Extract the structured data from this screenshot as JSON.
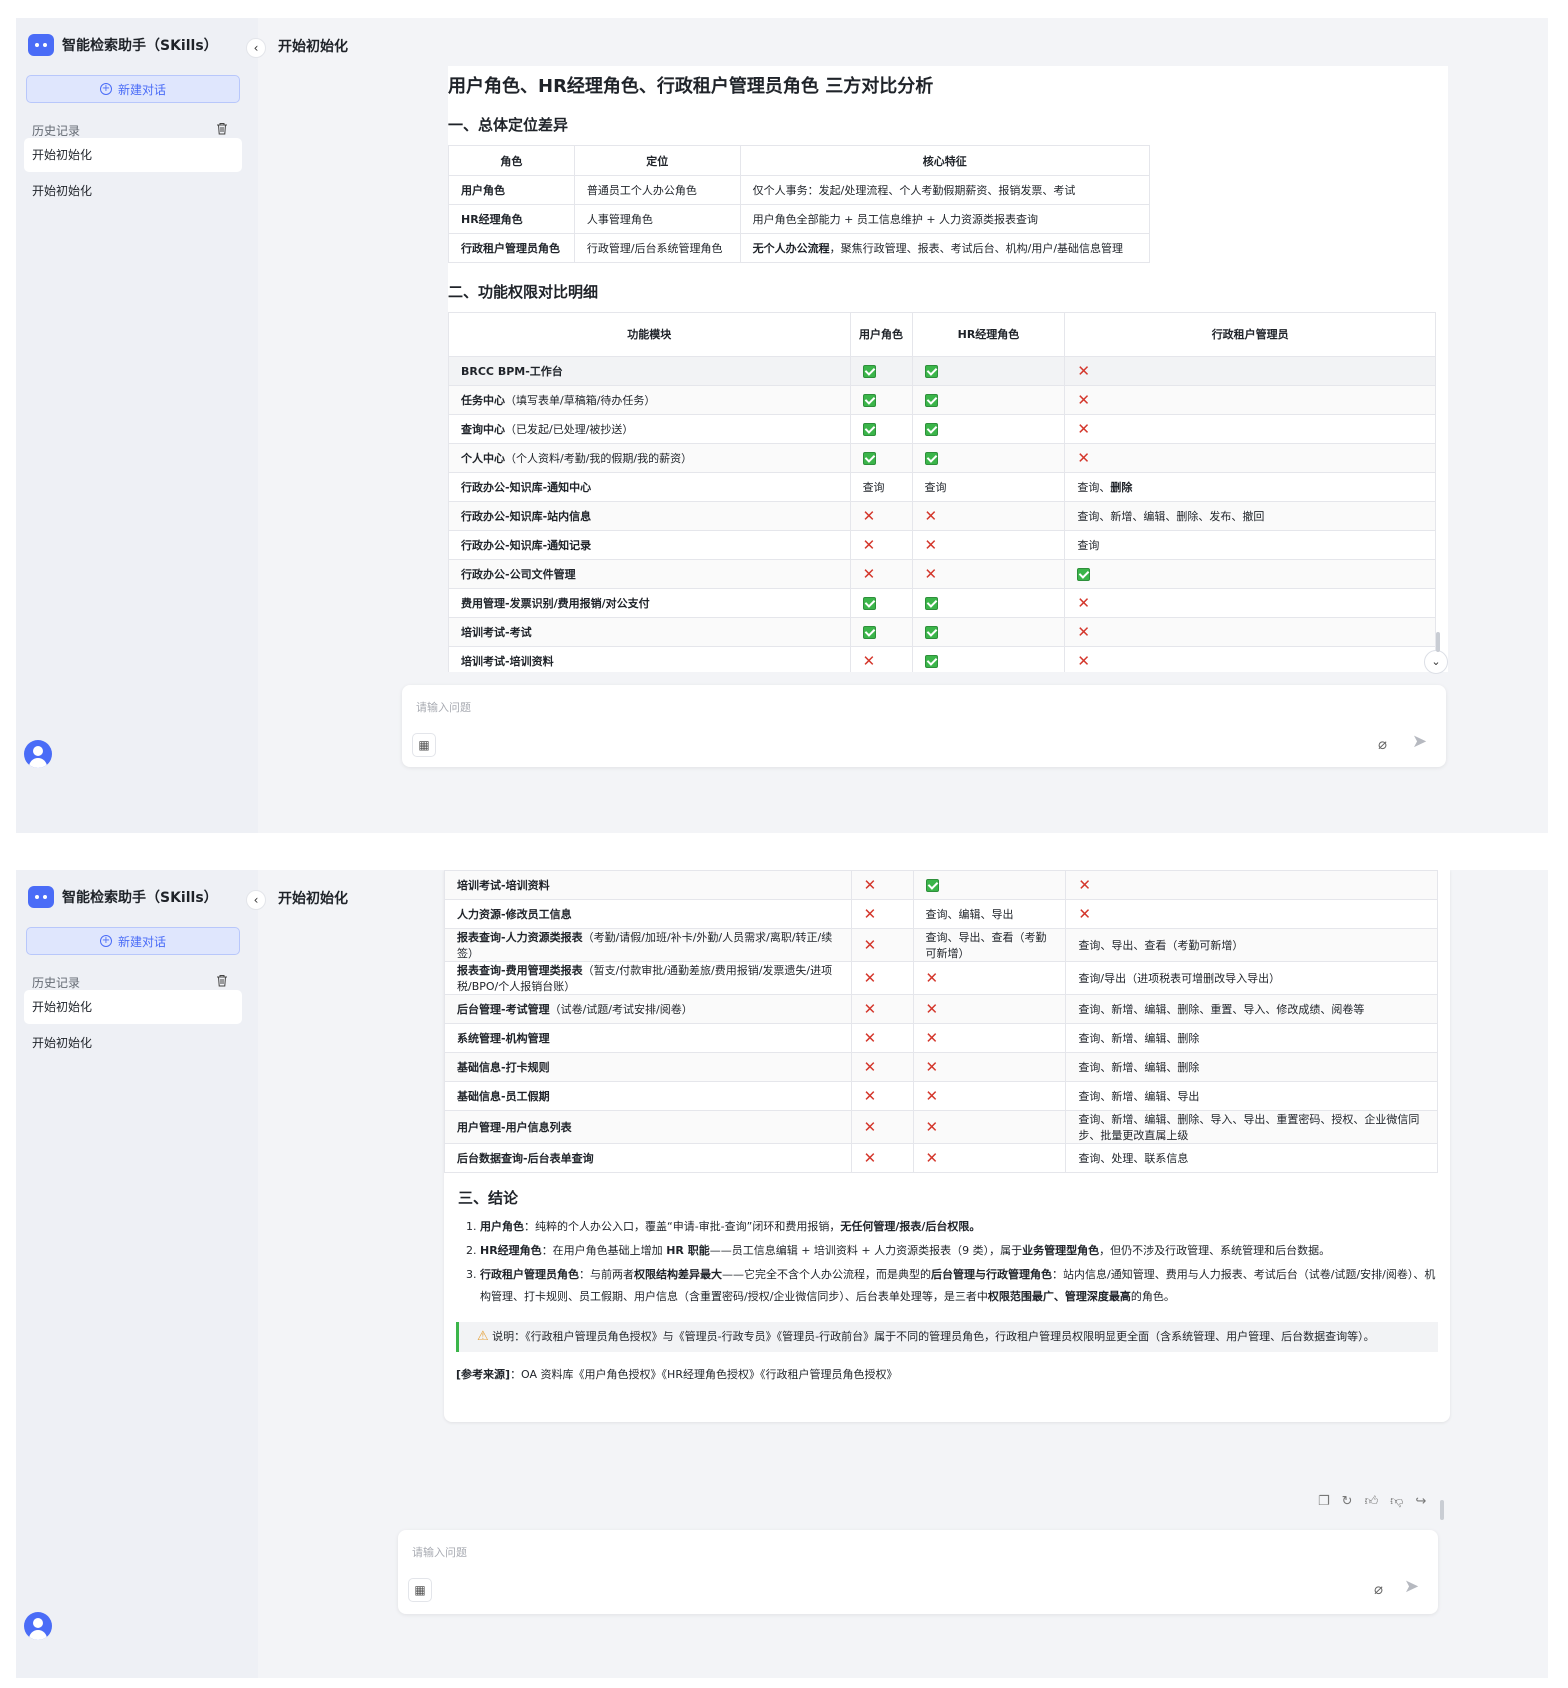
{
  "app": {
    "title": "智能检索助手（SKills）",
    "new_chat": "新建对话",
    "history_label": "历史记录",
    "history": [
      "开始初始化",
      "开始初始化"
    ]
  },
  "conversation": {
    "title": "开始初始化"
  },
  "input": {
    "placeholder": "请输入问题"
  },
  "report": {
    "title": "用户角色、HR经理角色、行政租户管理员角色 三方对比分析",
    "sec1": "一、总体定位差异",
    "sec2": "二、功能权限对比明细",
    "sec3": "三、结论"
  },
  "position_table": {
    "headers": [
      "角色",
      "定位",
      "核心特征"
    ],
    "rows": [
      [
        "用户角色",
        "普通员工个人办公角色",
        "仅个人事务：发起/处理流程、个人考勤假期薪资、报销发票、考试"
      ],
      [
        "HR经理角色",
        "人事管理角色",
        "用户角色全部能力 + 员工信息维护 + 人力资源类报表查询"
      ],
      [
        "行政租户管理员角色",
        "行政管理/后台系统管理角色",
        {
          "bold": "无个人办公流程",
          "rest": "，聚焦行政管理、报表、考试后台、机构/用户/基础信息管理"
        }
      ]
    ]
  },
  "perm_table": {
    "headers": [
      "功能模块",
      "用户角色",
      "HR经理角色",
      "行政租户管理员"
    ],
    "rows_top": [
      [
        {
          "b": "BRCC BPM-工作台",
          "n": ""
        },
        "yes",
        "yes",
        "no"
      ],
      [
        {
          "b": "任务中心",
          "n": "（填写表单/草稿箱/待办任务）"
        },
        "yes",
        "yes",
        "no"
      ],
      [
        {
          "b": "查询中心",
          "n": "（已发起/已处理/被抄送）"
        },
        "yes",
        "yes",
        "no"
      ],
      [
        {
          "b": "个人中心",
          "n": "（个人资料/考勤/我的假期/我的薪资）"
        },
        "yes",
        "yes",
        "no"
      ],
      [
        {
          "b": "行政办公-知识库-通知中心",
          "n": ""
        },
        "查询",
        "查询",
        {
          "t": "查询、",
          "b": "删除"
        }
      ],
      [
        {
          "b": "行政办公-知识库-站内信息",
          "n": ""
        },
        "no",
        "no",
        "查询、新增、编辑、删除、发布、撤回"
      ],
      [
        {
          "b": "行政办公-知识库-通知记录",
          "n": ""
        },
        "no",
        "no",
        "查询"
      ],
      [
        {
          "b": "行政办公-公司文件管理",
          "n": ""
        },
        "no",
        "no",
        "yes"
      ],
      [
        {
          "b": "费用管理-发票识别/费用报销/对公支付",
          "n": ""
        },
        "yes",
        "yes",
        "no"
      ],
      [
        {
          "b": "培训考试-考试",
          "n": ""
        },
        "yes",
        "yes",
        "no"
      ],
      [
        {
          "b": "培训考试-培训资料",
          "n": ""
        },
        "no",
        "yes",
        "no"
      ]
    ],
    "rows_bottom": [
      [
        {
          "b": "培训考试-培训资料",
          "n": ""
        },
        "no",
        "yes",
        "no"
      ],
      [
        {
          "b": "人力资源-修改员工信息",
          "n": ""
        },
        "no",
        "查询、编辑、导出",
        "no"
      ],
      [
        {
          "b": "报表查询-人力资源类报表",
          "n": "（考勤/请假/加班/补卡/外勤/人员需求/离职/转正/续签）"
        },
        "no",
        "查询、导出、查看（考勤可新增）",
        "查询、导出、查看（考勤可新增）"
      ],
      [
        {
          "b": "报表查询-费用管理类报表",
          "n": "（暂支/付款审批/通勤差旅/费用报销/发票遗失/进项税/BPO/个人报销台账）"
        },
        "no",
        "no",
        "查询/导出（进项税表可增删改导入导出）"
      ],
      [
        {
          "b": "后台管理-考试管理",
          "n": "（试卷/试题/考试安排/阅卷）"
        },
        "no",
        "no",
        "查询、新增、编辑、删除、重置、导入、修改成绩、阅卷等"
      ],
      [
        {
          "b": "系统管理-机构管理",
          "n": ""
        },
        "no",
        "no",
        "查询、新增、编辑、删除"
      ],
      [
        {
          "b": "基础信息-打卡规则",
          "n": ""
        },
        "no",
        "no",
        "查询、新增、编辑、删除"
      ],
      [
        {
          "b": "基础信息-员工假期",
          "n": ""
        },
        "no",
        "no",
        "查询、新增、编辑、导出"
      ],
      [
        {
          "b": "用户管理-用户信息列表",
          "n": ""
        },
        "no",
        "no",
        "查询、新增、编辑、删除、导入、导出、重置密码、授权、企业微信同步、批量更改直属上级"
      ],
      [
        {
          "b": "后台数据查询-后台表单查询",
          "n": ""
        },
        "no",
        "no",
        "查询、处理、联系信息"
      ]
    ]
  },
  "conclusion": {
    "items": [
      [
        {
          "b": "用户角色"
        },
        {
          "t": "：纯粹的个人办公入口，覆盖“申请-审批-查询”闭环和费用报销，"
        },
        {
          "b": "无任何管理/报表/后台权限。"
        }
      ],
      [
        {
          "b": "HR经理角色"
        },
        {
          "t": "：在用户角色基础上增加 "
        },
        {
          "b": "HR 职能"
        },
        {
          "t": "——员工信息编辑 + 培训资料 + 人力资源类报表（9 类），属于"
        },
        {
          "b": "业务管理型角色"
        },
        {
          "t": "，但仍不涉及行政管理、系统管理和后台数据。"
        }
      ],
      [
        {
          "b": "行政租户管理员角色"
        },
        {
          "t": "：与前两者"
        },
        {
          "b": "权限结构差异最大"
        },
        {
          "t": "——它完全不含个人办公流程，而是典型的"
        },
        {
          "b": "后台管理与行政管理角色"
        },
        {
          "t": "：站内信息/通知管理、费用与人力报表、考试后台（试卷/试题/安排/阅卷）、机构管理、打卡规则、员工假期、用户信息（含重置密码/授权/企业微信同步）、后台表单处理等，是三者中"
        },
        {
          "b": "权限范围最广、管理深度最高"
        },
        {
          "t": "的角色。"
        }
      ]
    ],
    "note": "说明：《行政租户管理员角色授权》与《管理员-行政专员》《管理员-行政前台》属于不同的管理员角色，行政租户管理员权限明显更全面（含系统管理、用户管理、后台数据查询等）。",
    "ref_label": "[参考来源]",
    "ref_text": "：OA 资料库《用户角色授权》《HR经理角色授权》《行政租户管理员角色授权》"
  }
}
